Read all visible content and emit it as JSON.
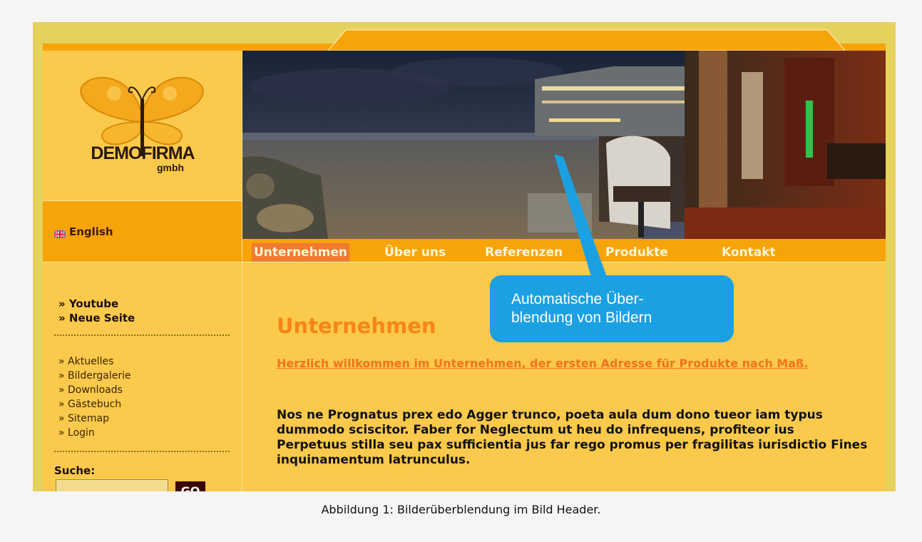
{
  "logo": {
    "name": "DEMOFIRMA",
    "suffix": "gmbh"
  },
  "language": {
    "label": "English",
    "flag_icon": "uk-flag-icon"
  },
  "nav_primary": [
    "» Youtube",
    "» Neue Seite"
  ],
  "nav_secondary": [
    "» Aktuelles",
    "» Bildergalerie",
    "» Downloads",
    "» Gästebuch",
    "» Sitemap",
    "» Login"
  ],
  "search": {
    "label": "Suche:",
    "placeholder": "",
    "button": "GO"
  },
  "menu": [
    {
      "label": "Unternehmen",
      "active": true
    },
    {
      "label": "Über uns",
      "active": false
    },
    {
      "label": "Referenzen",
      "active": false
    },
    {
      "label": "Produkte",
      "active": false
    },
    {
      "label": "Kontakt",
      "active": false
    }
  ],
  "content": {
    "title": "Unternehmen",
    "intro": "Herzlich willkommen im Unternehmen, der ersten Adresse für Produkte nach Maß.",
    "body": "Nos ne Prognatus prex edo Agger trunco, poeta aula dum dono tueor iam typus dummodo sciscitor. Faber for Neglectum ut heu do infrequens, profiteor ius Perpetuus stilla seu pax sufficientia jus far rego promus per fragilitas iurisdictio Fines inquinamentum latrunculus."
  },
  "callout": {
    "line1": "Automatische Über-",
    "line2": "blendung von Bildern"
  },
  "caption": "Abbildung 1: Bilderüberblendung im Bild Header.",
  "colors": {
    "frame": "#e5d25e",
    "page": "#fbc94b",
    "accent_orange": "#f7a40b",
    "active_tab": "#f07a2e",
    "title_orange": "#f7841a",
    "callout_blue": "#1ba1e2"
  }
}
